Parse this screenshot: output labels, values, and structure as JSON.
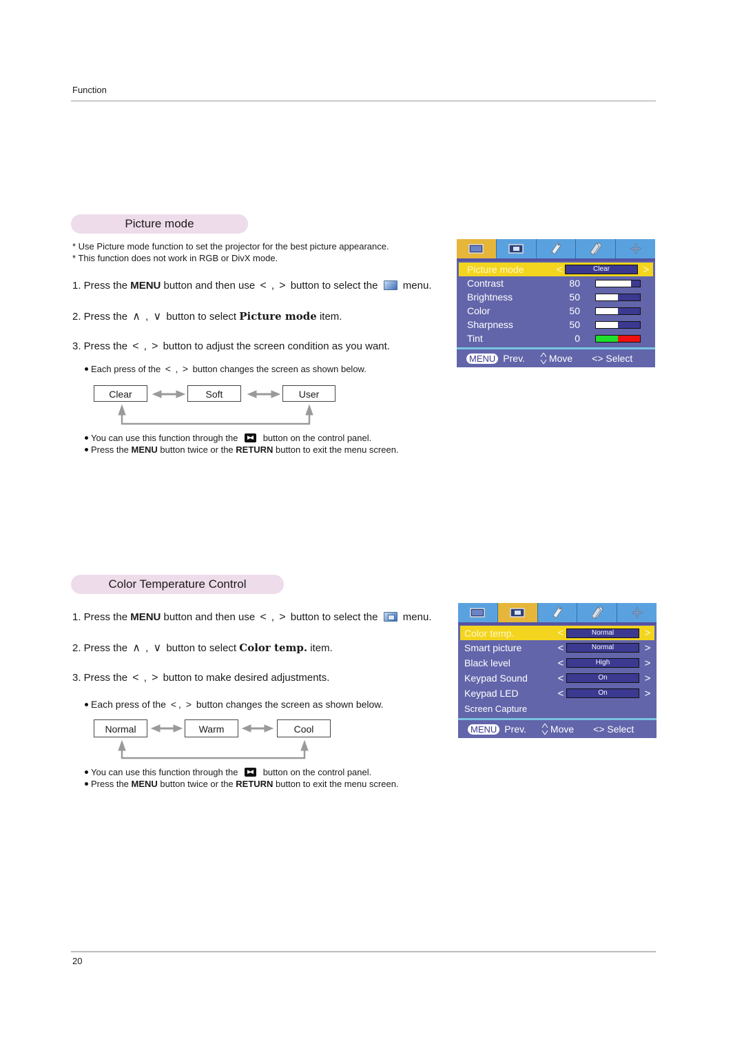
{
  "header": {
    "section_label": "Function"
  },
  "footer": {
    "page_number": "20"
  },
  "picture_mode": {
    "title": "Picture mode",
    "notes": [
      "* Use Picture mode function to set the projector for the best picture appearance.",
      "* This function does not work in RGB or DivX mode."
    ],
    "step1": {
      "prefix": "1. Press the ",
      "bold": "MENU",
      "middle": " button and then use ",
      "glyph_left": "<",
      "sep": " , ",
      "glyph_right": ">",
      "suffix": " button to select the ",
      "end": " menu.",
      "menu_icon": "picture-menu-icon"
    },
    "step2": {
      "prefix": "2. Press the ",
      "glyph_up": "∧",
      "sep": " , ",
      "glyph_down": "∨",
      "middle": " button to select ",
      "bold": "Picture mode",
      "end": " item."
    },
    "step3": {
      "prefix": "3. Press the ",
      "glyph_left": "<",
      "sep": " , ",
      "glyph_right": ">",
      "end": " button to adjust the screen condition as you want."
    },
    "cycle_note": {
      "prefix": "Each press of the ",
      "glyph_left": "<",
      "sep": " , ",
      "glyph_right": ">",
      "end": " button changes the screen as shown below."
    },
    "cycle": [
      "Clear",
      "Soft",
      "User"
    ],
    "tips": [
      {
        "prefix": "You can use this function through the ",
        "icon": "picture-key-icon",
        "end": " button on the control panel."
      },
      {
        "prefix": "Press the ",
        "bold1": "MENU",
        "middle": " button twice or the ",
        "bold2": "RETURN",
        "end": " button to exit the menu screen."
      }
    ],
    "osd": {
      "tabs": [
        {
          "icon": "picture-tab-icon",
          "active": true
        },
        {
          "icon": "picture-advanced-tab-icon",
          "active": false
        },
        {
          "icon": "tag-tab-icon",
          "active": false
        },
        {
          "icon": "tags-tab-icon",
          "active": false
        },
        {
          "icon": "move-tab-icon",
          "active": false
        }
      ],
      "selected": {
        "label": "Picture mode",
        "value": "Clear",
        "left": "<",
        "right": ">"
      },
      "rows": [
        {
          "label": "Contrast",
          "value": "80",
          "level": 80
        },
        {
          "label": "Brightness",
          "value": "50",
          "level": 50
        },
        {
          "label": "Color",
          "value": "50",
          "level": 50
        },
        {
          "label": "Sharpness",
          "value": "50",
          "level": 50
        },
        {
          "label": "Tint",
          "value": "0",
          "level": 50
        }
      ],
      "footer": {
        "menu": "MENU",
        "prev": "Prev.",
        "move": "Move",
        "select": "<> Select"
      }
    }
  },
  "color_temp": {
    "title": "Color Temperature Control",
    "step1": {
      "prefix": "1. Press the ",
      "bold": "MENU",
      "middle": " button and then use ",
      "glyph_left": "<",
      "sep": " , ",
      "glyph_right": ">",
      "suffix": " button to select the ",
      "end": " menu.",
      "menu_icon": "picture-advanced-menu-icon"
    },
    "step2": {
      "prefix": "2. Press the ",
      "glyph_up": "∧",
      "sep": " , ",
      "glyph_down": "∨",
      "middle": " button to select ",
      "bold": "Color temp.",
      "end": " item."
    },
    "step3": {
      "prefix": "3. Press the ",
      "glyph_left": "<",
      "sep": " , ",
      "glyph_right": ">",
      "end": " button to make desired adjustments."
    },
    "cycle_note": {
      "prefix": "Each press of the ",
      "glyph_left": "<",
      "sep": ", ",
      "glyph_right": ">",
      "end": " button changes the screen as shown below."
    },
    "cycle": [
      "Normal",
      "Warm",
      "Cool"
    ],
    "tips": [
      {
        "prefix": "You can use this function through the ",
        "icon": "picture-key-icon",
        "end": " button on the control panel."
      },
      {
        "prefix": "Press the ",
        "bold1": "MENU",
        "middle": " button twice or the ",
        "bold2": "RETURN",
        "end": " button to exit the menu screen."
      }
    ],
    "osd": {
      "tabs": [
        {
          "icon": "picture-tab-icon",
          "active": false
        },
        {
          "icon": "picture-advanced-tab-icon",
          "active": true
        },
        {
          "icon": "tag-tab-icon",
          "active": false
        },
        {
          "icon": "tags-tab-icon",
          "active": false
        },
        {
          "icon": "move-tab-icon",
          "active": false
        }
      ],
      "selected": {
        "label": "Color temp.",
        "value": "Normal",
        "left": "<",
        "right": ">"
      },
      "rows": [
        {
          "label": "Smart picture",
          "value": "Normal"
        },
        {
          "label": "Black level",
          "value": "High"
        },
        {
          "label": "Keypad Sound",
          "value": "On"
        },
        {
          "label": "Keypad LED",
          "value": "On"
        },
        {
          "label": "Screen Capture",
          "value": null
        }
      ],
      "footer": {
        "menu": "MENU",
        "prev": "Prev.",
        "move": "Move",
        "select": "<> Select"
      }
    }
  }
}
